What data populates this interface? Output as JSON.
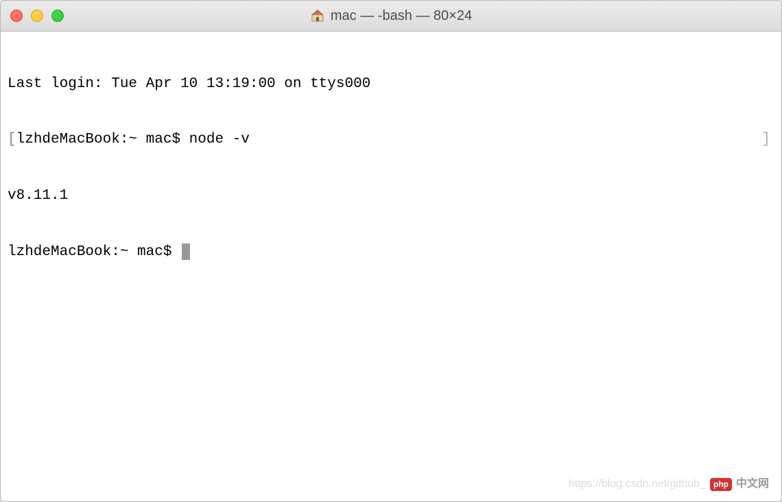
{
  "window": {
    "title": "mac — -bash — 80×24"
  },
  "terminal": {
    "lines": [
      "Last login: Tue Apr 10 13:19:00 on ttys000",
      "lzhdeMacBook:~ mac$ node -v",
      "v8.11.1",
      "lzhdeMacBook:~ mac$ "
    ],
    "line0": "Last login: Tue Apr 10 13:19:00 on ttys000",
    "line1": "lzhdeMacBook:~ mac$ node -v",
    "line2": "v8.11.1",
    "line3": "lzhdeMacBook:~ mac$ "
  },
  "watermark": {
    "url": "https://blog.csdn.net/github_",
    "badge": "php",
    "cn": "中文网"
  }
}
